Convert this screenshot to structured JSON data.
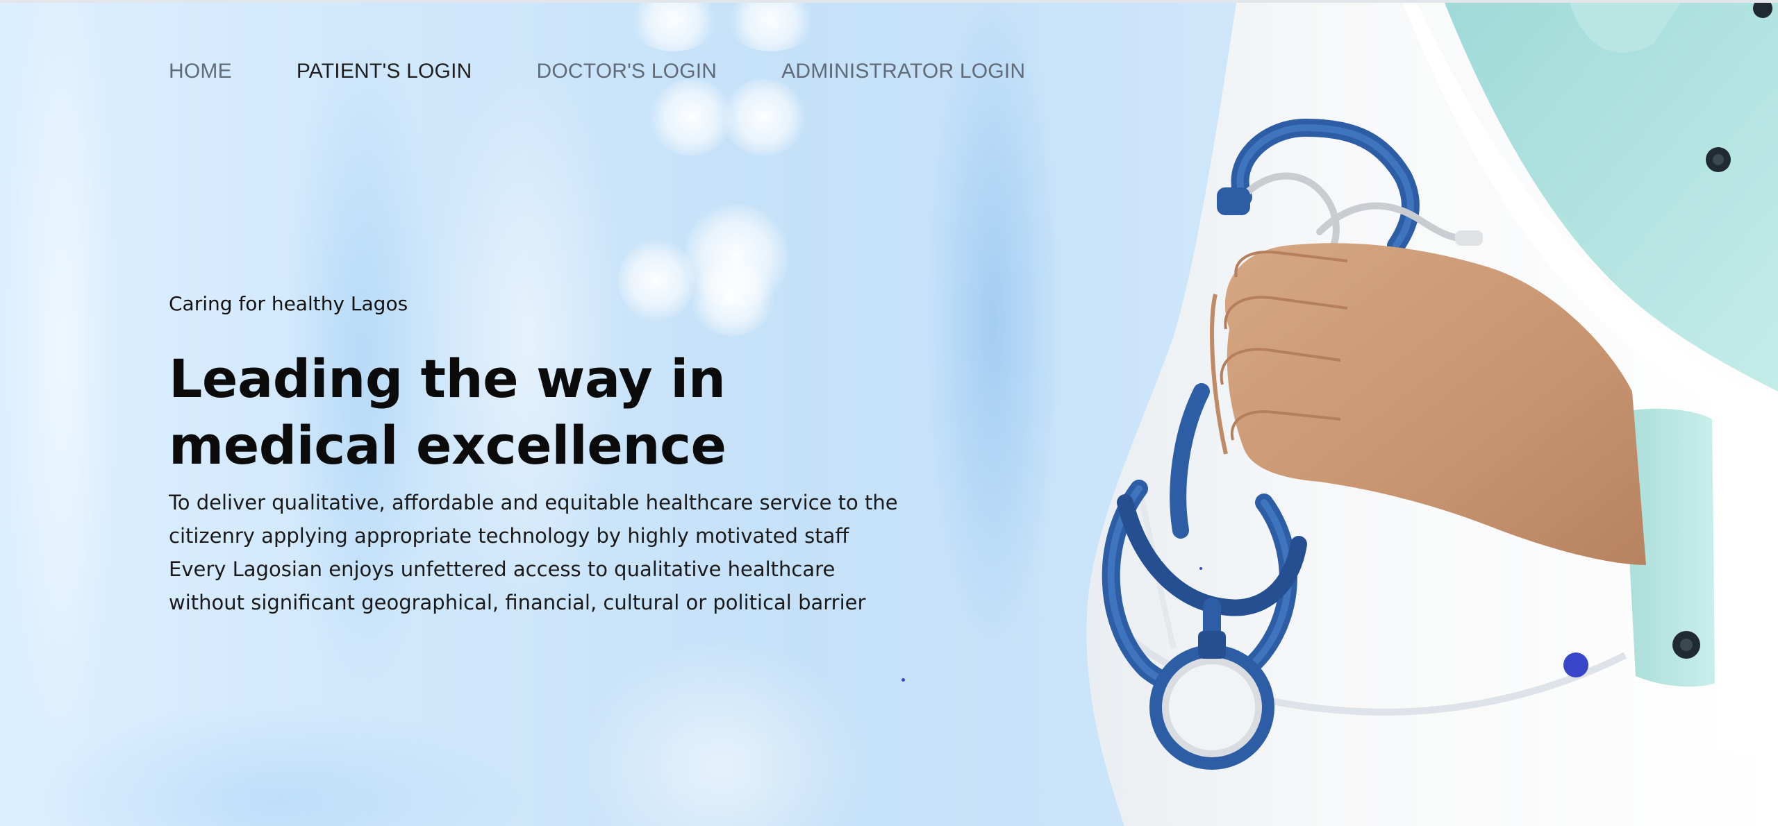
{
  "nav": {
    "items": [
      {
        "label": "HOME",
        "active": false
      },
      {
        "label": "PATIENT'S LOGIN",
        "active": true
      },
      {
        "label": "DOCTOR'S LOGIN",
        "active": false
      },
      {
        "label": "ADMINISTRATOR LOGIN",
        "active": false
      }
    ]
  },
  "hero": {
    "tagline": "Caring for healthy Lagos",
    "headline": "Leading the way in medical excellence",
    "description_line1": "To deliver qualitative, affordable and equitable healthcare service to the citizenry applying appropriate technology by highly motivated staff",
    "description_line2": "Every Lagosian enjoys unfettered access to qualitative healthcare without significant geographical, financial, cultural or political barrier"
  },
  "colors": {
    "accent_dot": "#3a46c9",
    "nav_inactive": "#5f6b78",
    "nav_active": "#1e1e1e",
    "background": "#c9e3f9"
  },
  "icons": {
    "hero_image": "doctor-with-stethoscope-image"
  }
}
